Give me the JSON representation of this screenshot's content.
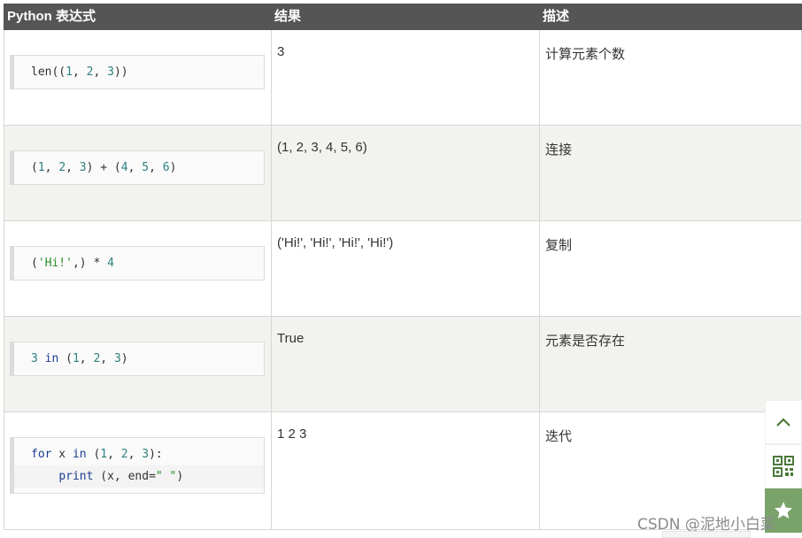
{
  "table": {
    "headers": [
      "Python 表达式",
      "结果",
      "描述"
    ],
    "rows": [
      {
        "code_lines": [
          [
            {
              "t": "len((",
              "c": "fn"
            },
            {
              "t": "1",
              "c": "num"
            },
            {
              "t": ", ",
              "c": "fn"
            },
            {
              "t": "2",
              "c": "num"
            },
            {
              "t": ", ",
              "c": "fn"
            },
            {
              "t": "3",
              "c": "num"
            },
            {
              "t": "))",
              "c": "fn"
            }
          ]
        ],
        "result": "3",
        "description": "计算元素个数"
      },
      {
        "code_lines": [
          [
            {
              "t": "(",
              "c": "fn"
            },
            {
              "t": "1",
              "c": "num"
            },
            {
              "t": ", ",
              "c": "fn"
            },
            {
              "t": "2",
              "c": "num"
            },
            {
              "t": ", ",
              "c": "fn"
            },
            {
              "t": "3",
              "c": "num"
            },
            {
              "t": ") + (",
              "c": "fn"
            },
            {
              "t": "4",
              "c": "num"
            },
            {
              "t": ", ",
              "c": "fn"
            },
            {
              "t": "5",
              "c": "num"
            },
            {
              "t": ", ",
              "c": "fn"
            },
            {
              "t": "6",
              "c": "num"
            },
            {
              "t": ")",
              "c": "fn"
            }
          ]
        ],
        "result": "(1, 2, 3, 4, 5, 6)",
        "description": "连接"
      },
      {
        "code_lines": [
          [
            {
              "t": "(",
              "c": "fn"
            },
            {
              "t": "'Hi!'",
              "c": "str"
            },
            {
              "t": ",) * ",
              "c": "fn"
            },
            {
              "t": "4",
              "c": "num"
            }
          ]
        ],
        "result": "('Hi!', 'Hi!', 'Hi!', 'Hi!')",
        "description": "复制"
      },
      {
        "code_lines": [
          [
            {
              "t": "3",
              "c": "num"
            },
            {
              "t": " in ",
              "c": "kw"
            },
            {
              "t": "(",
              "c": "fn"
            },
            {
              "t": "1",
              "c": "num"
            },
            {
              "t": ", ",
              "c": "fn"
            },
            {
              "t": "2",
              "c": "num"
            },
            {
              "t": ", ",
              "c": "fn"
            },
            {
              "t": "3",
              "c": "num"
            },
            {
              "t": ")",
              "c": "fn"
            }
          ]
        ],
        "result": "True",
        "description": "元素是否存在"
      },
      {
        "code_lines": [
          [
            {
              "t": "for",
              "c": "kw"
            },
            {
              "t": " x ",
              "c": "fn"
            },
            {
              "t": "in",
              "c": "kw"
            },
            {
              "t": " (",
              "c": "fn"
            },
            {
              "t": "1",
              "c": "num"
            },
            {
              "t": ", ",
              "c": "fn"
            },
            {
              "t": "2",
              "c": "num"
            },
            {
              "t": ", ",
              "c": "fn"
            },
            {
              "t": "3",
              "c": "num"
            },
            {
              "t": "):",
              "c": "fn"
            }
          ],
          [
            {
              "t": "    ",
              "c": "fn"
            },
            {
              "t": "print",
              "c": "kw"
            },
            {
              "t": " (x, end=",
              "c": "fn"
            },
            {
              "t": "\" \"",
              "c": "str"
            },
            {
              "t": ")",
              "c": "fn"
            }
          ]
        ],
        "result": "1 2 3",
        "description": "迭代"
      }
    ]
  },
  "side_tools": {
    "items": [
      {
        "icon": "chevron-up-icon"
      },
      {
        "icon": "qr-code-icon"
      },
      {
        "icon": "star-icon"
      }
    ]
  },
  "watermark": "CSDN @泥地小白菜",
  "colors": {
    "header_bg": "#555555",
    "alt_row_bg": "#f2f2ee",
    "accent_green": "#7aa36b"
  }
}
